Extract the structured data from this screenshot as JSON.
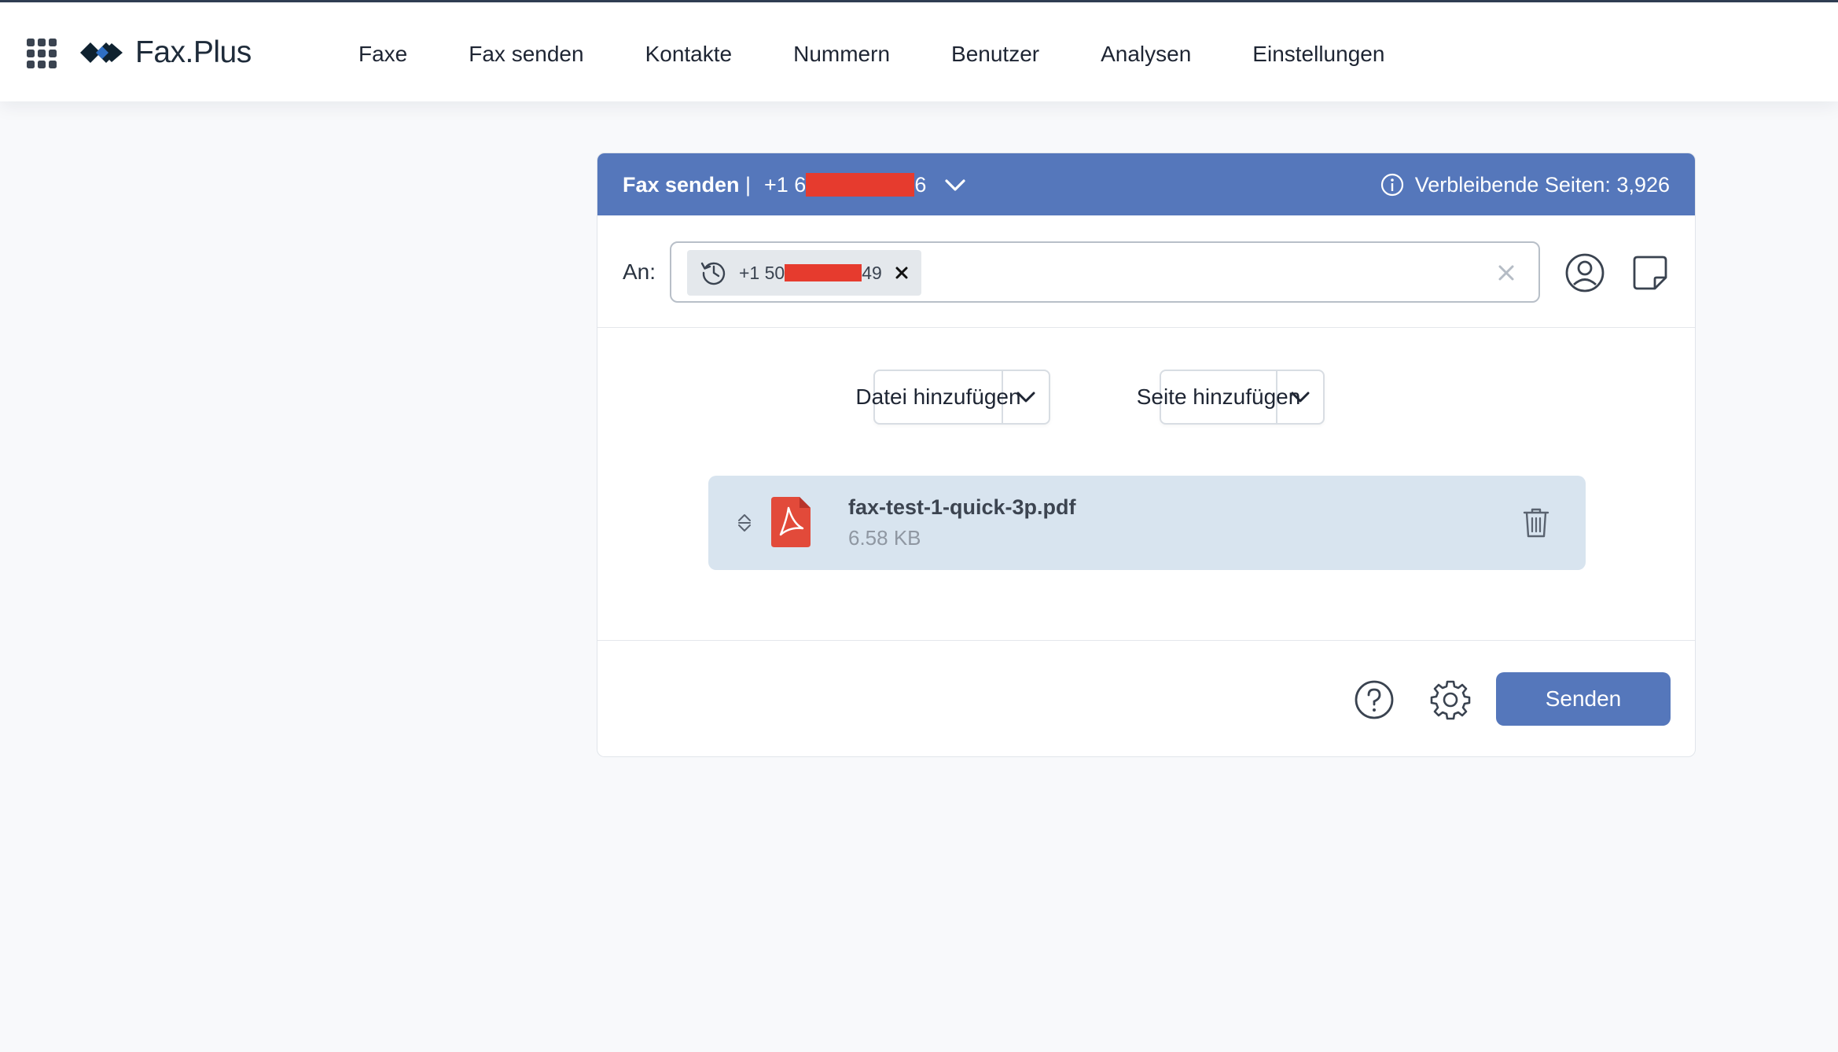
{
  "app": {
    "name": "Fax.Plus"
  },
  "nav": {
    "items": [
      {
        "label": "Faxe"
      },
      {
        "label": "Fax senden"
      },
      {
        "label": "Kontakte"
      },
      {
        "label": "Nummern"
      },
      {
        "label": "Benutzer"
      },
      {
        "label": "Analysen"
      },
      {
        "label": "Einstellungen"
      }
    ]
  },
  "send_fax": {
    "title": "Fax senden",
    "separator": "|",
    "from_number": {
      "prefix": "+1 6",
      "suffix": "6"
    },
    "remaining_pages": "Verbleibende Seiten: 3,926",
    "to_label": "An:",
    "recipient": {
      "prefix": "+1 50",
      "suffix": "49"
    },
    "add_file_label": "Datei hinzufügen",
    "add_page_label": "Seite hinzufügen",
    "file": {
      "name": "fax-test-1-quick-3p.pdf",
      "size": "6.58 KB"
    },
    "send_label": "Senden"
  },
  "colors": {
    "accent": "#5577bb",
    "redaction": "#e63b2e",
    "file_row_bg": "#d8e4ef",
    "pdf_red": "#e24a3a"
  },
  "icons": [
    "app-grid-icon",
    "fax-plus-logo",
    "chevron-down-icon",
    "info-icon",
    "history-icon",
    "close-icon",
    "clear-icon",
    "contact-icon",
    "note-icon",
    "drag-handle-icon",
    "pdf-file-icon",
    "trash-icon",
    "help-icon",
    "gear-icon"
  ]
}
